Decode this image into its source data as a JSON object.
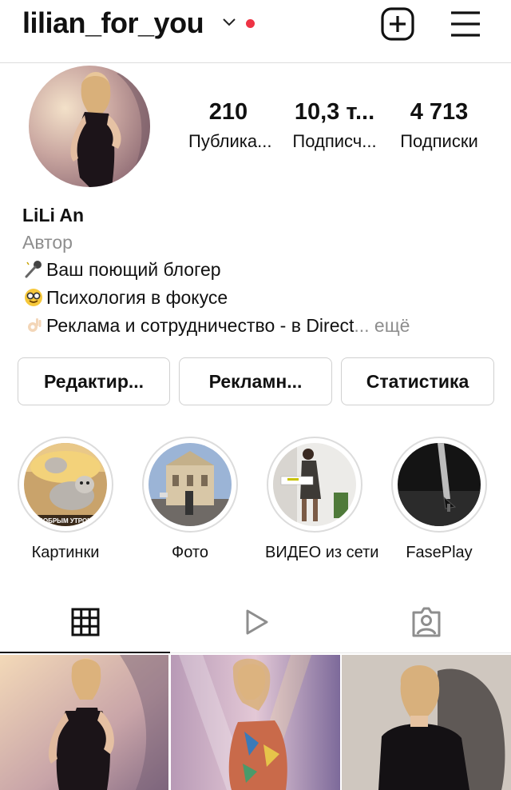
{
  "header": {
    "username": "lilian_for_you",
    "icons": {
      "dropdown": "chevron-down-icon",
      "notification": "red-dot",
      "create": "plus-square-icon",
      "menu": "hamburger-menu-icon"
    },
    "accent_color": "#ee3344"
  },
  "profile": {
    "stats": [
      {
        "value": "210",
        "label": "Публика..."
      },
      {
        "value": "10,3 т...",
        "label": "Подписч..."
      },
      {
        "value": "4 713",
        "label": "Подписки"
      }
    ],
    "name": "LiLi An",
    "category": "Автор",
    "bio": [
      {
        "icon": "microphone-emoji-icon",
        "text": "Ваш поющий блогер"
      },
      {
        "icon": "nerd-face-emoji-icon",
        "text": "Психология в фокусе"
      },
      {
        "icon": "ok-hand-emoji-icon",
        "text": "Реклама и сотрудничество - в Direct"
      }
    ],
    "more_text": "... ещё"
  },
  "actions": {
    "edit_label": "Редактир...",
    "ads_label": "Рекламн...",
    "stats_label": "Статистика"
  },
  "highlights": [
    {
      "label": "Картинки",
      "caption_on_image": "ДОБРЫМ УТРОМ"
    },
    {
      "label": "Фото"
    },
    {
      "label": "ВИДЕО из сети"
    },
    {
      "label": "FasePlay"
    }
  ],
  "tabs": [
    {
      "name": "grid",
      "icon": "grid-icon",
      "active": true
    },
    {
      "name": "reels",
      "icon": "play-icon",
      "active": false
    },
    {
      "name": "tagged",
      "icon": "tagged-person-icon",
      "active": false
    }
  ]
}
